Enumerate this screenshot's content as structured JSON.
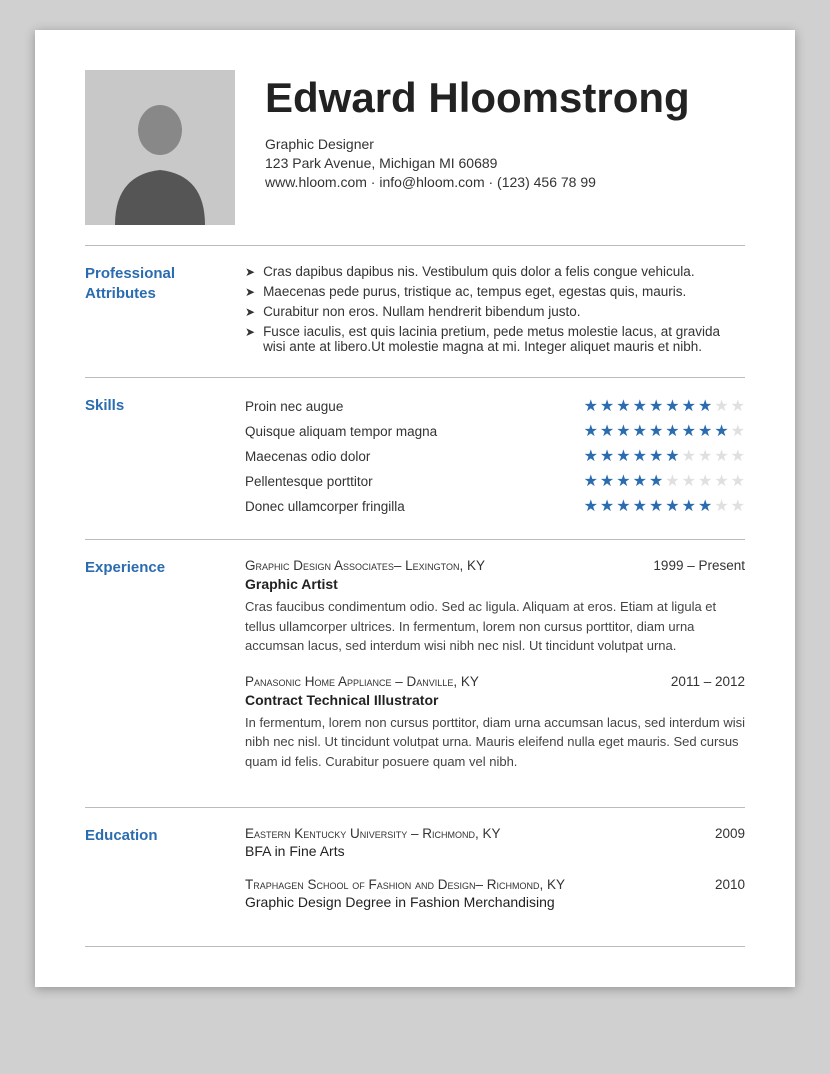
{
  "header": {
    "name": "Edward Hloomstrong",
    "title": "Graphic Designer",
    "address": "123 Park Avenue, Michigan MI 60689",
    "contact": "www.hloom.com · info@hloom.com · (123) 456 78 99"
  },
  "sections": {
    "professional": {
      "label": "Professional\nAttributes",
      "items": [
        "Cras dapibus dapibus nis. Vestibulum quis dolor a felis congue vehicula.",
        "Maecenas pede purus, tristique ac, tempus eget, egestas quis, mauris.",
        "Curabitur non eros. Nullam hendrerit bibendum justo.",
        "Fusce iaculis, est quis lacinia pretium, pede metus molestie lacus, at gravida wisi ante at libero.Ut molestie magna at mi. Integer aliquet mauris et nibh."
      ]
    },
    "skills": {
      "label": "Skills",
      "items": [
        {
          "name": "Proin nec augue",
          "filled": 8,
          "total": 10
        },
        {
          "name": "Quisque aliquam tempor magna",
          "filled": 9,
          "total": 10
        },
        {
          "name": "Maecenas odio dolor",
          "filled": 6,
          "total": 10
        },
        {
          "name": "Pellentesque porttitor",
          "filled": 5,
          "total": 10
        },
        {
          "name": "Donec ullamcorper fringilla",
          "filled": 8,
          "total": 10
        }
      ]
    },
    "experience": {
      "label": "Experience",
      "items": [
        {
          "company": "Graphic Design Associates– Lexington, KY",
          "dates": "1999 – Present",
          "title": "Graphic Artist",
          "desc": "Cras faucibus condimentum odio. Sed ac ligula. Aliquam at eros. Etiam at ligula et tellus ullamcorper ultrices. In fermentum, lorem non cursus porttitor, diam urna accumsan lacus, sed interdum wisi nibh nec nisl. Ut tincidunt volutpat urna."
        },
        {
          "company": "Panasonic Home Appliance – Danville, KY",
          "dates": "2011 – 2012",
          "title": "Contract Technical Illustrator",
          "desc": "In fermentum, lorem non cursus porttitor, diam urna accumsan lacus, sed interdum wisi nibh nec nisl. Ut tincidunt volutpat urna. Mauris eleifend nulla eget mauris. Sed cursus quam id felis. Curabitur posuere quam vel nibh."
        }
      ]
    },
    "education": {
      "label": "Education",
      "items": [
        {
          "school": "Eastern Kentucky University – Richmond, KY",
          "year": "2009",
          "degree": "BFA in Fine Arts"
        },
        {
          "school": "Traphagen School of Fashion and Design– Richmond, KY",
          "year": "2010",
          "degree": "Graphic Design Degree in Fashion Merchandising"
        }
      ]
    }
  }
}
